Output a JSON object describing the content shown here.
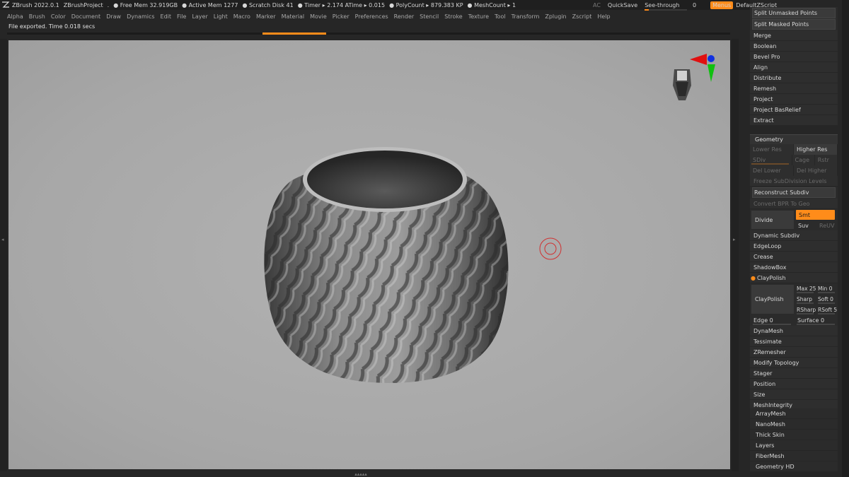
{
  "titlebar": {
    "app": "ZBrush 2022.0.1",
    "project": "ZBrushProject",
    "dot": ".",
    "free_mem": "● Free Mem 32.919GB",
    "active_mem": "● Active Mem 1277",
    "scratch": "● Scratch Disk 41",
    "timer": "● Timer ▸ 2.174 ATime ▸ 0.015",
    "polycount": "● PolyCount ▸ 879.383 KP",
    "meshcount": "● MeshCount ▸ 1"
  },
  "status_right": {
    "ac": "AC",
    "quicksave": "QuickSave",
    "seethrough_label": "See-through",
    "seethrough_value": "0",
    "menus": "Menus",
    "script": "DefaultZScript"
  },
  "menu": [
    "Alpha",
    "Brush",
    "Color",
    "Document",
    "Draw",
    "Dynamics",
    "Edit",
    "File",
    "Layer",
    "Light",
    "Macro",
    "Marker",
    "Material",
    "Movie",
    "Picker",
    "Preferences",
    "Render",
    "Stencil",
    "Stroke",
    "Texture",
    "Tool",
    "Transform",
    "Zplugin",
    "Zscript",
    "Help"
  ],
  "notice": "File exported. Time 0.018 secs",
  "progress": 0.44,
  "panel_top": {
    "split_unmasked": "Split Unmasked Points",
    "split_masked": "Split Masked Points",
    "items": [
      "Merge",
      "Boolean",
      "Bevel Pro",
      "Align",
      "Distribute",
      "Remesh",
      "Project",
      "Project BasRelief",
      "Extract"
    ]
  },
  "geometry": {
    "header": "Geometry",
    "lower_res": "Lower Res",
    "higher_res": "Higher Res",
    "sdiv": "SDiv",
    "cage": "Cage",
    "rstr": "Rstr",
    "del_lower": "Del Lower",
    "del_higher": "Del Higher",
    "freeze": "Freeze SubDivision Levels",
    "reconstruct": "Reconstruct Subdiv",
    "convert_bpr": "Convert BPR To Geo",
    "divide": "Divide",
    "smt": "Smt",
    "suv": "Suv",
    "reuv": "ReUV",
    "dynamic_subdiv": "Dynamic Subdiv",
    "edgeloop": "EdgeLoop",
    "crease": "Crease",
    "shadowbox": "ShadowBox",
    "claypolish_head": "ClayPolish",
    "claypolish": "ClayPolish",
    "max": "Max 25",
    "min": "Min 0",
    "sharp": "Sharp",
    "soft": "Soft 0",
    "rsharp": "RSharp",
    "rsoft": "RSoft 5",
    "edge": "Edge 0",
    "surface": "Surface 0",
    "items": [
      "DynaMesh",
      "Tessimate",
      "ZRemesher",
      "Modify Topology",
      "Stager",
      "Position",
      "Size",
      "MeshIntegrity"
    ]
  },
  "tail_items": [
    "ArrayMesh",
    "NanoMesh",
    "Thick Skin",
    "Layers",
    "FiberMesh",
    "Geometry HD"
  ],
  "colors": {
    "accent": "#ff8c1a",
    "viewport": "#aaaaaa"
  }
}
